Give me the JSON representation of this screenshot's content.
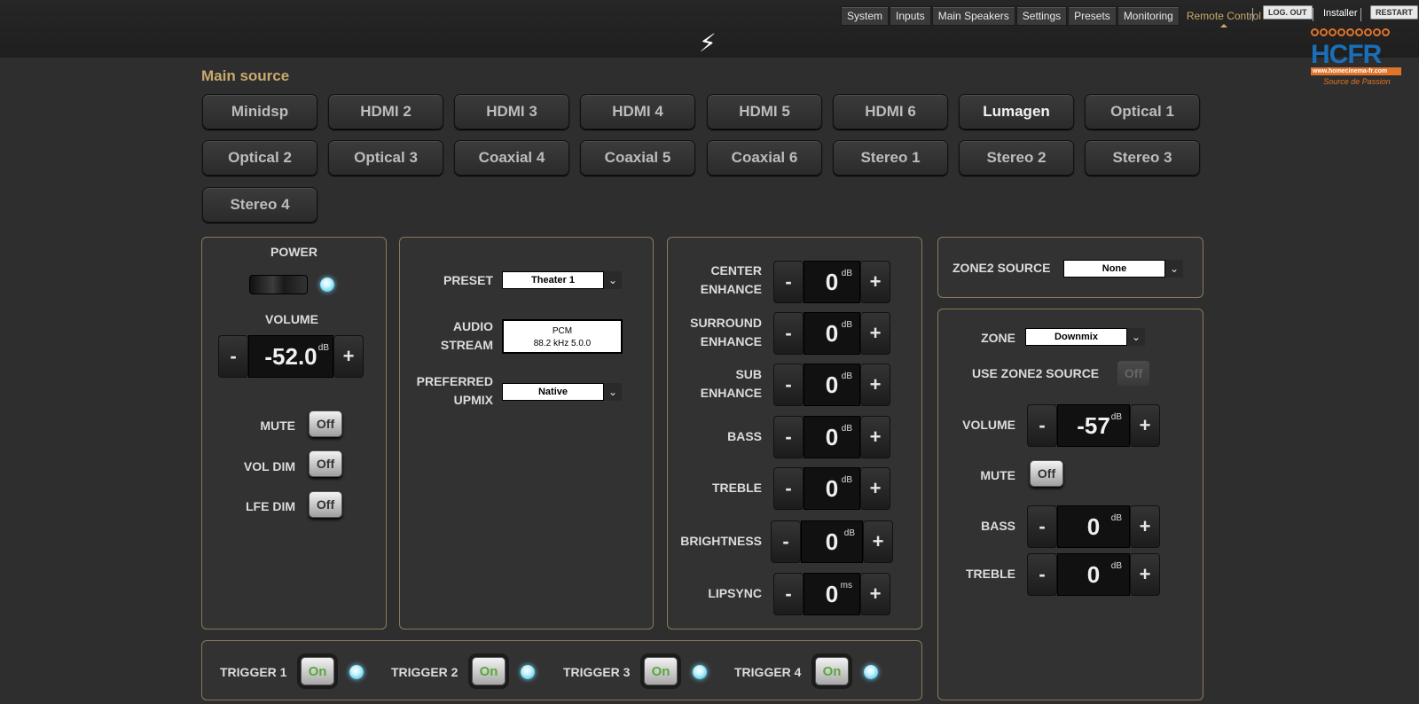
{
  "nav": {
    "tabs": [
      "System",
      "Inputs",
      "Main Speakers",
      "Settings",
      "Presets",
      "Monitoring",
      "Remote Control"
    ],
    "active_tab": "Remote Control",
    "logout_label": "LOG. OUT",
    "user_label": "Installer",
    "restart_label": "RESTART",
    "bolt_icon": "⚡"
  },
  "logo": {
    "main": "HCFR",
    "url": "www.homecinema-fr.com",
    "tagline": "Source de Passion"
  },
  "main_source": {
    "title": "Main source",
    "selected": "Lumagen",
    "sources": [
      "Minidsp",
      "HDMI 2",
      "HDMI 3",
      "HDMI 4",
      "HDMI 5",
      "HDMI 6",
      "Lumagen",
      "Optical 1",
      "Optical 2",
      "Optical 3",
      "Coaxial 4",
      "Coaxial 5",
      "Coaxial 6",
      "Stereo 1",
      "Stereo 2",
      "Stereo 3",
      "Stereo 4"
    ]
  },
  "power": {
    "power_label": "POWER",
    "volume_label": "VOLUME",
    "volume_value": "-52.0",
    "volume_unit": "dB",
    "minus": "-",
    "plus": "+",
    "mute_label": "MUTE",
    "mute_value": "Off",
    "voldim_label": "VOL DIM",
    "voldim_value": "Off",
    "lfedim_label": "LFE DIM",
    "lfedim_value": "Off"
  },
  "audio": {
    "preset_label": "PRESET",
    "preset_value": "Theater 1",
    "stream_label_1": "AUDIO",
    "stream_label_2": "STREAM",
    "stream_line1": "PCM",
    "stream_line2": "88.2 kHz 5.0.0",
    "upmix_label_1": "PREFERRED",
    "upmix_label_2": "UPMIX",
    "upmix_value": "Native",
    "arrow": "⌄"
  },
  "enhance": [
    {
      "label1": "CENTER",
      "label2": "ENHANCE",
      "value": "0",
      "unit": "dB"
    },
    {
      "label1": "SURROUND",
      "label2": "ENHANCE",
      "value": "0",
      "unit": "dB"
    },
    {
      "label1": "SUB",
      "label2": "ENHANCE",
      "value": "0",
      "unit": "dB"
    },
    {
      "label1": "BASS",
      "label2": "",
      "value": "0",
      "unit": "dB"
    },
    {
      "label1": "TREBLE",
      "label2": "",
      "value": "0",
      "unit": "dB"
    },
    {
      "label1": "BRIGHTNESS",
      "label2": "",
      "value": "0",
      "unit": "dB"
    },
    {
      "label1": "LIPSYNC",
      "label2": "",
      "value": "0",
      "unit": "ms"
    }
  ],
  "zone2_source": {
    "label": "ZONE2 SOURCE",
    "value": "None"
  },
  "zone": {
    "zone_label": "ZONE",
    "zone_value": "Downmix",
    "use_label": "USE ZONE2 SOURCE",
    "use_value": "Off",
    "volume_label": "VOLUME",
    "volume_value": "-57",
    "volume_unit": "dB",
    "mute_label": "MUTE",
    "mute_value": "Off",
    "bass_label": "BASS",
    "bass_value": "0",
    "bass_unit": "dB",
    "treble_label": "TREBLE",
    "treble_value": "0",
    "treble_unit": "dB"
  },
  "triggers": [
    {
      "label": "TRIGGER 1",
      "value": "On"
    },
    {
      "label": "TRIGGER 2",
      "value": "On"
    },
    {
      "label": "TRIGGER 3",
      "value": "On"
    },
    {
      "label": "TRIGGER 4",
      "value": "On"
    }
  ]
}
